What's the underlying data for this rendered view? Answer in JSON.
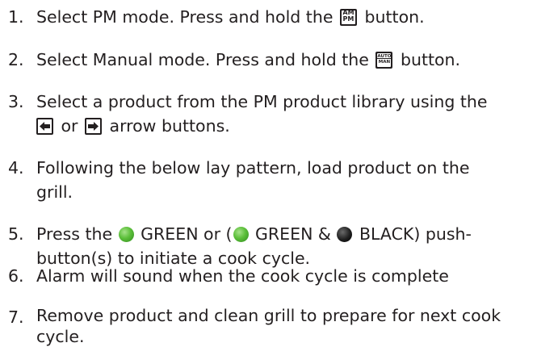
{
  "steps": [
    {
      "num": "1.",
      "a": "Select PM mode.  Press and hold the ",
      "b": " button."
    },
    {
      "num": "2.",
      "a": "Select Manual mode.  Press and hold the ",
      "b": " button."
    },
    {
      "num": "3.",
      "a": "Select a product from the PM product library using the",
      "b": " or ",
      "c": " arrow buttons."
    },
    {
      "num": "4.",
      "a": "Following the below lay pattern, load product on the",
      "b": "grill."
    },
    {
      "num": "5.",
      "a": "Press the ",
      "b": " GREEN or (",
      "c": " GREEN & ",
      "d": " BLACK) push-",
      "e": "button(s) to initiate a cook cycle."
    },
    {
      "num": "6.",
      "a": "Alarm will sound when the cook cycle is complete"
    },
    {
      "num": "7.",
      "a": "Remove product and clean grill to prepare for next cook",
      "b": "cycle."
    }
  ],
  "icons": {
    "ampm_top": "AM",
    "ampm_bottom": "PM",
    "automan_top": "AUTO",
    "automan_bottom": "MAN"
  },
  "colors": {
    "green_button": "#5cbf3a",
    "black_button": "#000000",
    "text": "#231f20"
  }
}
